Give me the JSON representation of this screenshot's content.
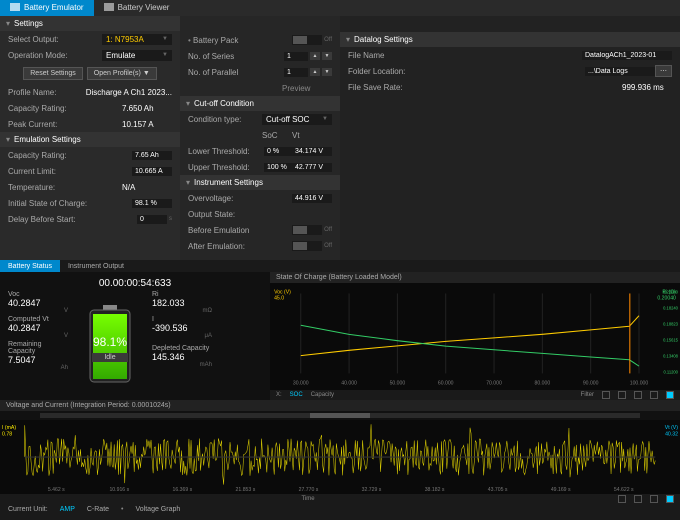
{
  "tabs": {
    "emulator": "Battery Emulator",
    "viewer": "Battery Viewer"
  },
  "settings": {
    "title": "Settings",
    "select_output_lbl": "Select Output:",
    "select_output_val": "1: N7953A",
    "op_mode_lbl": "Operation Mode:",
    "op_mode_val": "Emulate",
    "reset_btn": "Reset Settings",
    "open_btn": "Open Profile(s)",
    "profile_name_lbl": "Profile Name:",
    "profile_name_val": "Discharge A Ch1 2023...",
    "cap_rating_lbl": "Capacity Rating:",
    "cap_rating_val": "7.650 Ah",
    "peak_lbl": "Peak Current:",
    "peak_val": "10.157 A",
    "emu_title": "Emulation Settings",
    "e_cap_lbl": "Capacity Rating:",
    "e_cap_val": "7.65 Ah",
    "e_cur_lbl": "Current Limit:",
    "e_cur_val": "10.665 A",
    "e_temp_lbl": "Temperature:",
    "e_temp_val": "N/A",
    "e_soc_lbl": "Initial State of Charge:",
    "e_soc_val": "98.1 %",
    "e_delay_lbl": "Delay Before Start:",
    "e_delay_val": "0",
    "e_delay_unit": "s"
  },
  "mid": {
    "bp_lbl": "Battery Pack",
    "bp_val": "Off",
    "ns_lbl": "No. of Series",
    "ns_val": "1",
    "np_lbl": "No. of Parallel",
    "np_val": "1",
    "preview": "Preview",
    "cut_title": "Cut-off Condition",
    "ct_lbl": "Condition type:",
    "ct_val": "Cut-off SOC",
    "soc_h": "SoC",
    "vt_h": "Vt",
    "low_lbl": "Lower Threshold:",
    "low_soc": "0 %",
    "low_vt": "34.174 V",
    "up_lbl": "Upper Threshold:",
    "up_soc": "100 %",
    "up_vt": "42.777 V",
    "inst_title": "Instrument Settings",
    "ov_lbl": "Overvoltage:",
    "ov_val": "44.916 V",
    "os_lbl": "Output State:",
    "be_lbl": "Before Emulation",
    "be_val": "Off",
    "ae_lbl": "After Emulation:",
    "ae_val": "Off"
  },
  "dlog": {
    "title": "Datalog Settings",
    "fn_lbl": "File Name",
    "fn_val": "DatalogACh1_2023-01",
    "fl_lbl": "Folder Location:",
    "fl_val": "...\\Data Logs",
    "fs_lbl": "File Save Rate:",
    "fs_val": "999.936 ms"
  },
  "btabs": {
    "status": "Battery Status",
    "inst": "Instrument Output"
  },
  "stat": {
    "timer": "00.00:00:54:633",
    "voc_l": "Voc",
    "voc_v": "40.2847",
    "voc_u": "V",
    "ri_l": "Ri",
    "ri_v": "182.033",
    "ri_u": "mΩ",
    "cvt_l": "Computed Vt",
    "cvt_v": "40.2847",
    "cvt_u": "V",
    "i_l": "I",
    "i_v": "-390.536",
    "i_u": "μA",
    "rc_l": "Remaining Capacity",
    "rc_v": "7.5047",
    "rc_u": "Ah",
    "dc_l": "Depleted Capacity",
    "dc_v": "145.346",
    "dc_u": "mAh",
    "pct": "98.1%",
    "idle": "Idle"
  },
  "soc_chart": {
    "title": "State Of Charge (Battery Loaded Model)",
    "yl": "Voc (V)",
    "yr": "Ri (Ω)",
    "ylv": "45.0",
    "yrv": "0.20040",
    "x_label": "X:",
    "x_items": [
      "SOC",
      "Capacity"
    ],
    "filter": "Filter",
    "y_right_ticks": [
      "0.20040",
      "0.18240",
      "0.18823",
      "0.15615",
      "0.13408",
      "0.11200"
    ]
  },
  "vi_chart": {
    "title": "Voltage and Current (Integration Period: 0.0001024s)",
    "yl": "I (mA)",
    "yl_v": "0.78",
    "yr": "Vt (V)",
    "yr_v": "40.32",
    "xl": "Time"
  },
  "foot": {
    "cu": "Current Unit:",
    "amp": "AMP",
    "cr": "C-Rate",
    "vg": "Voltage Graph"
  },
  "chart_data": {
    "soc": {
      "type": "line",
      "xlabel": "State of Charge (%)",
      "x_ticks": [
        30,
        40,
        50,
        60,
        70,
        80,
        90,
        100
      ],
      "series": [
        {
          "name": "Voc",
          "axis": "left",
          "color": "#ffcc00",
          "x": [
            30,
            40,
            50,
            60,
            70,
            80,
            90,
            98,
            100
          ],
          "y": [
            38.0,
            38.6,
            39.1,
            39.6,
            40.0,
            40.4,
            40.9,
            41.3,
            42.5
          ]
        },
        {
          "name": "Ri",
          "axis": "right",
          "color": "#33cc66",
          "x": [
            30,
            40,
            50,
            60,
            70,
            80,
            90,
            98,
            100
          ],
          "y": [
            0.165,
            0.155,
            0.148,
            0.142,
            0.138,
            0.134,
            0.13,
            0.127,
            0.12
          ]
        }
      ],
      "ylim_left": [
        36,
        45
      ],
      "ylim_right": [
        0.112,
        0.2
      ],
      "marker_x": 98.1
    },
    "vi": {
      "type": "line",
      "xlabel": "Time (s)",
      "x_ticks": [
        "5.462 s",
        "10.916 s",
        "16.369 s",
        "21.853 s",
        "27.770 s",
        "32.729 s",
        "38.182 s",
        "43.705 s",
        "49.169 s",
        "54.622 s"
      ],
      "series": [
        {
          "name": "I",
          "axis": "left",
          "color": "#ffee00",
          "noise": true,
          "mean": 0,
          "amp": 0.6
        },
        {
          "name": "Vt",
          "axis": "right",
          "color": "#00ccff",
          "flat": 40.28
        }
      ],
      "ylim_left": [
        -0.78,
        0.78
      ],
      "ylim_right": [
        40.24,
        40.32
      ]
    }
  }
}
